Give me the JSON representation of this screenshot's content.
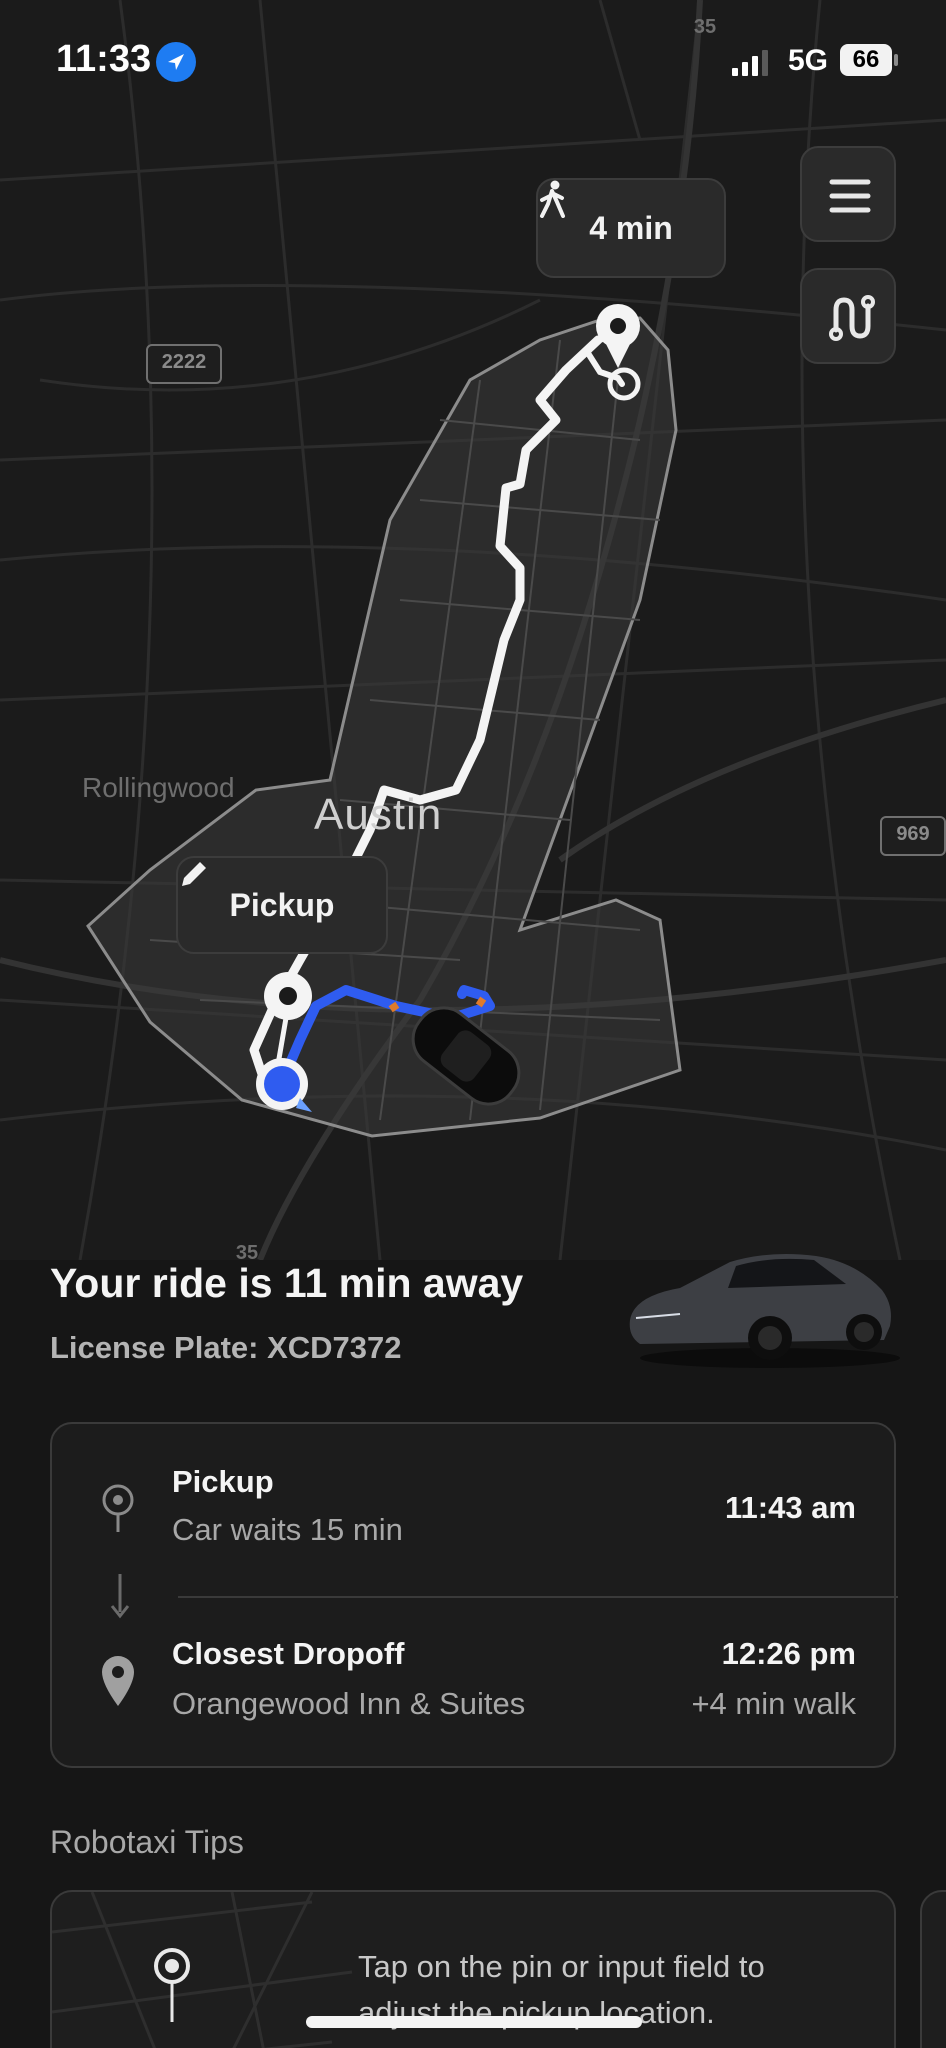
{
  "status_bar": {
    "time": "11:33",
    "network": "5G",
    "battery": "66"
  },
  "map": {
    "city_label": "Austin",
    "area_label": "Rollingwood",
    "shields": {
      "hwy_2222": "2222",
      "hwy_969": "969",
      "interstate_top": "35",
      "interstate_bottom": "35"
    },
    "walk_badge": "4 min",
    "pickup_tag": "Pickup"
  },
  "ride": {
    "title": "Your ride is 11 min away",
    "plate": "License Plate: XCD7372"
  },
  "trip": {
    "pickup": {
      "title": "Pickup",
      "subtitle": "Car waits 15 min",
      "time": "11:43 am"
    },
    "dropoff": {
      "title": "Closest Dropoff",
      "subtitle": "Orangewood Inn & Suites",
      "time": "12:26 pm",
      "walk": "+4 min walk"
    }
  },
  "tips": {
    "section_title": "Robotaxi Tips",
    "items": [
      {
        "text": "Tap on the pin or input field to adjust the pickup location."
      }
    ]
  },
  "colors": {
    "accent_blue": "#2f5cf0",
    "location_blue": "#1e7cf2",
    "background": "#161616"
  }
}
